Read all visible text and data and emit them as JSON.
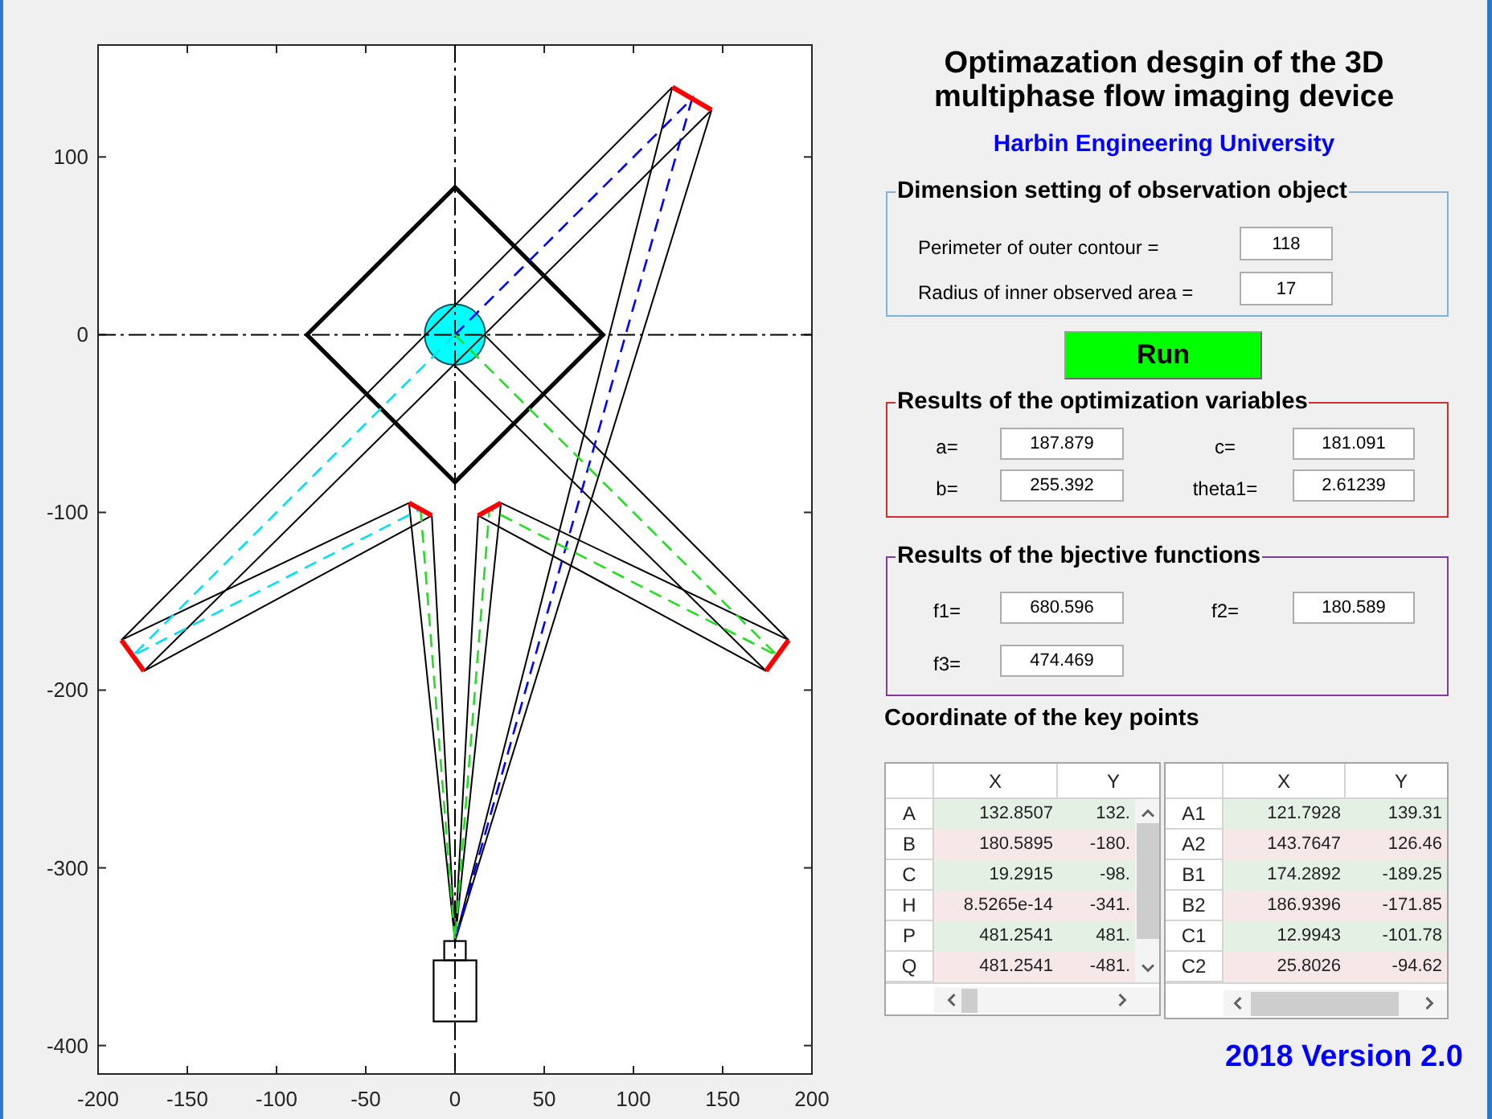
{
  "plot": {
    "x_tick_labels": [
      "-200",
      "-150",
      "-100",
      "-50",
      "0",
      "50",
      "100",
      "150",
      "200"
    ],
    "y_tick_labels": [
      "100",
      "0",
      "-100",
      "-200",
      "-300",
      "-400"
    ]
  },
  "title": "Optimazation desgin of the 3D multiphase flow imaging device",
  "subtitle": "Harbin Engineering University",
  "dimension_panel": {
    "title": "Dimension setting of observation object",
    "fields": [
      {
        "label": "Perimeter of outer contour =",
        "value": "118"
      },
      {
        "label": "Radius of inner observed area =",
        "value": "17"
      }
    ]
  },
  "run_button": "Run",
  "result_panels": [
    {
      "title": "Results of the optimization variables",
      "color": "#d22c2c",
      "fields": [
        {
          "label": "a=",
          "value": "187.879"
        },
        {
          "label": "c=",
          "value": "181.091"
        },
        {
          "label": "b=",
          "value": "255.392"
        },
        {
          "label": "theta1=",
          "value": "2.61239"
        }
      ]
    },
    {
      "title": "Results of the bjective functions",
      "color": "#7c3f8f",
      "fields": [
        {
          "label": "f1=",
          "value": "680.596"
        },
        {
          "label": "f2=",
          "value": "180.589"
        },
        {
          "label": "f3=",
          "value": "474.469"
        }
      ]
    }
  ],
  "key_points": {
    "title": "Coordinate of the key points",
    "tables": [
      {
        "columns": [
          "X",
          "Y"
        ],
        "rows": [
          {
            "label": "A",
            "cells": [
              "132.8507",
              "132."
            ]
          },
          {
            "label": "B",
            "cells": [
              "180.5895",
              "-180."
            ]
          },
          {
            "label": "C",
            "cells": [
              "19.2915",
              "-98."
            ]
          },
          {
            "label": "H",
            "cells": [
              "8.5265e-14",
              "-341."
            ]
          },
          {
            "label": "P",
            "cells": [
              "481.2541",
              "481."
            ]
          },
          {
            "label": "Q",
            "cells": [
              "481.2541",
              "-481."
            ]
          }
        ]
      },
      {
        "columns": [
          "X",
          "Y"
        ],
        "rows": [
          {
            "label": "A1",
            "cells": [
              "121.7928",
              "139.31"
            ]
          },
          {
            "label": "A2",
            "cells": [
              "143.7647",
              "126.46"
            ]
          },
          {
            "label": "B1",
            "cells": [
              "174.2892",
              "-189.25"
            ]
          },
          {
            "label": "B2",
            "cells": [
              "186.9396",
              "-171.85"
            ]
          },
          {
            "label": "C1",
            "cells": [
              "12.9943",
              "-101.78"
            ]
          },
          {
            "label": "C2",
            "cells": [
              "25.8026",
              "-94.62"
            ]
          }
        ]
      }
    ]
  },
  "version": "2018 Version 2.0"
}
